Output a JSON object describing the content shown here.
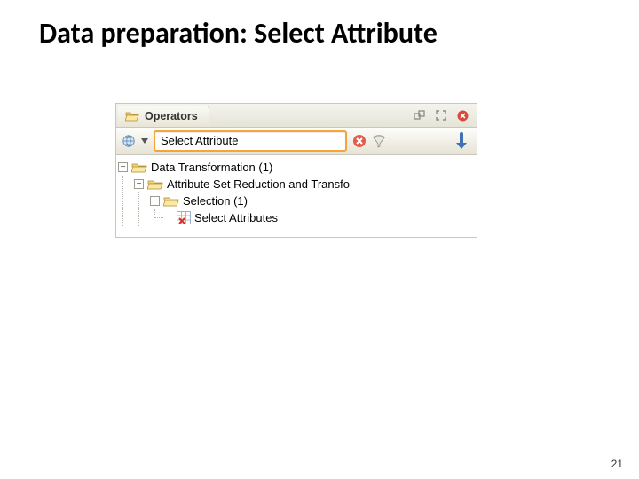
{
  "slide": {
    "title": "Data preparation: Select Attribute",
    "page_number": "21"
  },
  "panel": {
    "tab_label": "Operators",
    "search_value": "Select Attribute"
  },
  "tree": {
    "n0": {
      "label": "Data Transformation (1)"
    },
    "n1": {
      "label": "Attribute Set Reduction and Transfo"
    },
    "n2": {
      "label": "Selection (1)"
    },
    "n3": {
      "label": "Select Attributes"
    }
  }
}
